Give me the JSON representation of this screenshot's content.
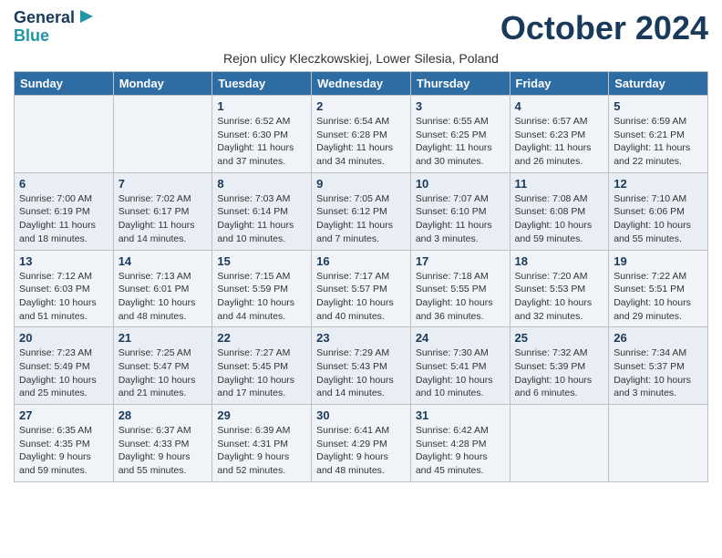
{
  "header": {
    "logo_line1": "General",
    "logo_line2": "Blue",
    "month_title": "October 2024",
    "subtitle": "Rejon ulicy Kleczkowskiej, Lower Silesia, Poland"
  },
  "weekdays": [
    "Sunday",
    "Monday",
    "Tuesday",
    "Wednesday",
    "Thursday",
    "Friday",
    "Saturday"
  ],
  "weeks": [
    [
      {
        "day": "",
        "info": ""
      },
      {
        "day": "",
        "info": ""
      },
      {
        "day": "1",
        "info": "Sunrise: 6:52 AM\nSunset: 6:30 PM\nDaylight: 11 hours and 37 minutes."
      },
      {
        "day": "2",
        "info": "Sunrise: 6:54 AM\nSunset: 6:28 PM\nDaylight: 11 hours and 34 minutes."
      },
      {
        "day": "3",
        "info": "Sunrise: 6:55 AM\nSunset: 6:25 PM\nDaylight: 11 hours and 30 minutes."
      },
      {
        "day": "4",
        "info": "Sunrise: 6:57 AM\nSunset: 6:23 PM\nDaylight: 11 hours and 26 minutes."
      },
      {
        "day": "5",
        "info": "Sunrise: 6:59 AM\nSunset: 6:21 PM\nDaylight: 11 hours and 22 minutes."
      }
    ],
    [
      {
        "day": "6",
        "info": "Sunrise: 7:00 AM\nSunset: 6:19 PM\nDaylight: 11 hours and 18 minutes."
      },
      {
        "day": "7",
        "info": "Sunrise: 7:02 AM\nSunset: 6:17 PM\nDaylight: 11 hours and 14 minutes."
      },
      {
        "day": "8",
        "info": "Sunrise: 7:03 AM\nSunset: 6:14 PM\nDaylight: 11 hours and 10 minutes."
      },
      {
        "day": "9",
        "info": "Sunrise: 7:05 AM\nSunset: 6:12 PM\nDaylight: 11 hours and 7 minutes."
      },
      {
        "day": "10",
        "info": "Sunrise: 7:07 AM\nSunset: 6:10 PM\nDaylight: 11 hours and 3 minutes."
      },
      {
        "day": "11",
        "info": "Sunrise: 7:08 AM\nSunset: 6:08 PM\nDaylight: 10 hours and 59 minutes."
      },
      {
        "day": "12",
        "info": "Sunrise: 7:10 AM\nSunset: 6:06 PM\nDaylight: 10 hours and 55 minutes."
      }
    ],
    [
      {
        "day": "13",
        "info": "Sunrise: 7:12 AM\nSunset: 6:03 PM\nDaylight: 10 hours and 51 minutes."
      },
      {
        "day": "14",
        "info": "Sunrise: 7:13 AM\nSunset: 6:01 PM\nDaylight: 10 hours and 48 minutes."
      },
      {
        "day": "15",
        "info": "Sunrise: 7:15 AM\nSunset: 5:59 PM\nDaylight: 10 hours and 44 minutes."
      },
      {
        "day": "16",
        "info": "Sunrise: 7:17 AM\nSunset: 5:57 PM\nDaylight: 10 hours and 40 minutes."
      },
      {
        "day": "17",
        "info": "Sunrise: 7:18 AM\nSunset: 5:55 PM\nDaylight: 10 hours and 36 minutes."
      },
      {
        "day": "18",
        "info": "Sunrise: 7:20 AM\nSunset: 5:53 PM\nDaylight: 10 hours and 32 minutes."
      },
      {
        "day": "19",
        "info": "Sunrise: 7:22 AM\nSunset: 5:51 PM\nDaylight: 10 hours and 29 minutes."
      }
    ],
    [
      {
        "day": "20",
        "info": "Sunrise: 7:23 AM\nSunset: 5:49 PM\nDaylight: 10 hours and 25 minutes."
      },
      {
        "day": "21",
        "info": "Sunrise: 7:25 AM\nSunset: 5:47 PM\nDaylight: 10 hours and 21 minutes."
      },
      {
        "day": "22",
        "info": "Sunrise: 7:27 AM\nSunset: 5:45 PM\nDaylight: 10 hours and 17 minutes."
      },
      {
        "day": "23",
        "info": "Sunrise: 7:29 AM\nSunset: 5:43 PM\nDaylight: 10 hours and 14 minutes."
      },
      {
        "day": "24",
        "info": "Sunrise: 7:30 AM\nSunset: 5:41 PM\nDaylight: 10 hours and 10 minutes."
      },
      {
        "day": "25",
        "info": "Sunrise: 7:32 AM\nSunset: 5:39 PM\nDaylight: 10 hours and 6 minutes."
      },
      {
        "day": "26",
        "info": "Sunrise: 7:34 AM\nSunset: 5:37 PM\nDaylight: 10 hours and 3 minutes."
      }
    ],
    [
      {
        "day": "27",
        "info": "Sunrise: 6:35 AM\nSunset: 4:35 PM\nDaylight: 9 hours and 59 minutes."
      },
      {
        "day": "28",
        "info": "Sunrise: 6:37 AM\nSunset: 4:33 PM\nDaylight: 9 hours and 55 minutes."
      },
      {
        "day": "29",
        "info": "Sunrise: 6:39 AM\nSunset: 4:31 PM\nDaylight: 9 hours and 52 minutes."
      },
      {
        "day": "30",
        "info": "Sunrise: 6:41 AM\nSunset: 4:29 PM\nDaylight: 9 hours and 48 minutes."
      },
      {
        "day": "31",
        "info": "Sunrise: 6:42 AM\nSunset: 4:28 PM\nDaylight: 9 hours and 45 minutes."
      },
      {
        "day": "",
        "info": ""
      },
      {
        "day": "",
        "info": ""
      }
    ]
  ]
}
